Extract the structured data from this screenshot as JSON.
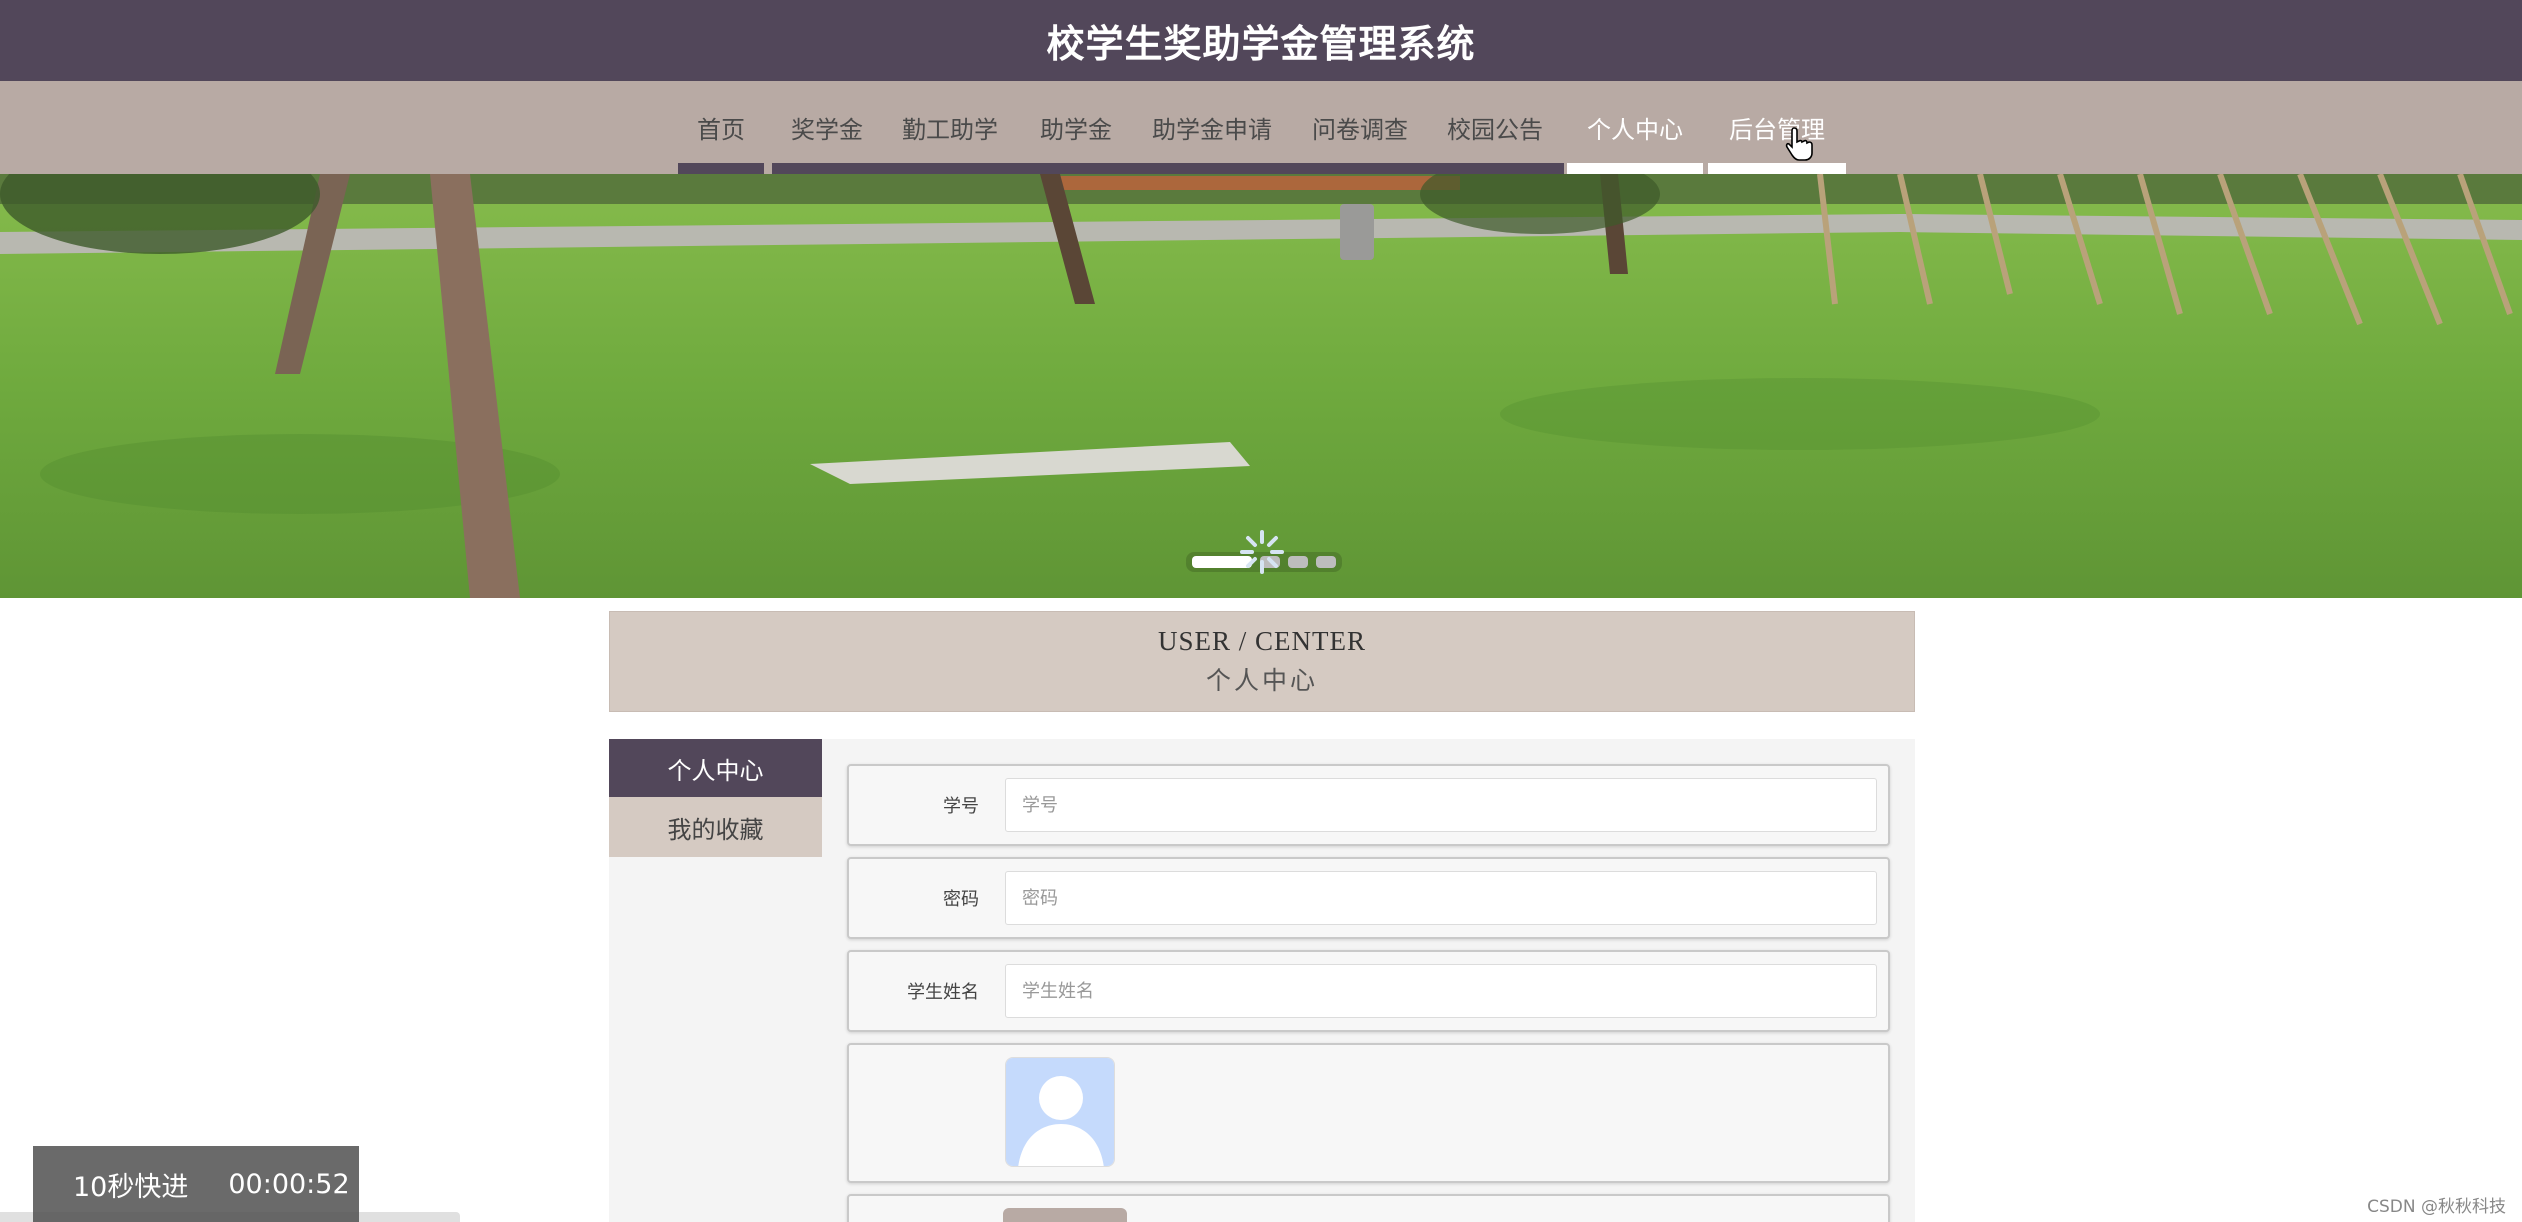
{
  "header": {
    "title": "校学生奖助学金管理系统"
  },
  "nav": {
    "items": [
      {
        "label": "首页",
        "active": false
      },
      {
        "label": "奖学金",
        "active": false
      },
      {
        "label": "勤工助学",
        "active": false
      },
      {
        "label": "助学金",
        "active": false
      },
      {
        "label": "助学金申请",
        "active": false
      },
      {
        "label": "问卷调查",
        "active": false
      },
      {
        "label": "校园公告",
        "active": false
      },
      {
        "label": "个人中心",
        "active": true
      },
      {
        "label": "后台管理",
        "active": true
      }
    ]
  },
  "banner": {
    "slide_count": 4,
    "active_slide": 1
  },
  "section": {
    "title_en": "USER / CENTER",
    "title_cn": "个人中心"
  },
  "side_menu": {
    "items": [
      {
        "label": "个人中心",
        "active": true
      },
      {
        "label": "我的收藏",
        "active": false
      }
    ]
  },
  "form": {
    "student_id": {
      "label": "学号",
      "placeholder": "学号",
      "value": ""
    },
    "password": {
      "label": "密码",
      "placeholder": "密码",
      "value": ""
    },
    "student_name": {
      "label": "学生姓名",
      "placeholder": "学生姓名",
      "value": ""
    }
  },
  "video_overlay": {
    "skip_label": "10秒快进",
    "timestamp": "00:00:52"
  },
  "watermark": "CSDN @秋秋科技",
  "colors": {
    "header_bg": "#52475a",
    "nav_bg": "#b8aaa4",
    "section_bg": "#d5cac2",
    "accent": "#52475a"
  }
}
